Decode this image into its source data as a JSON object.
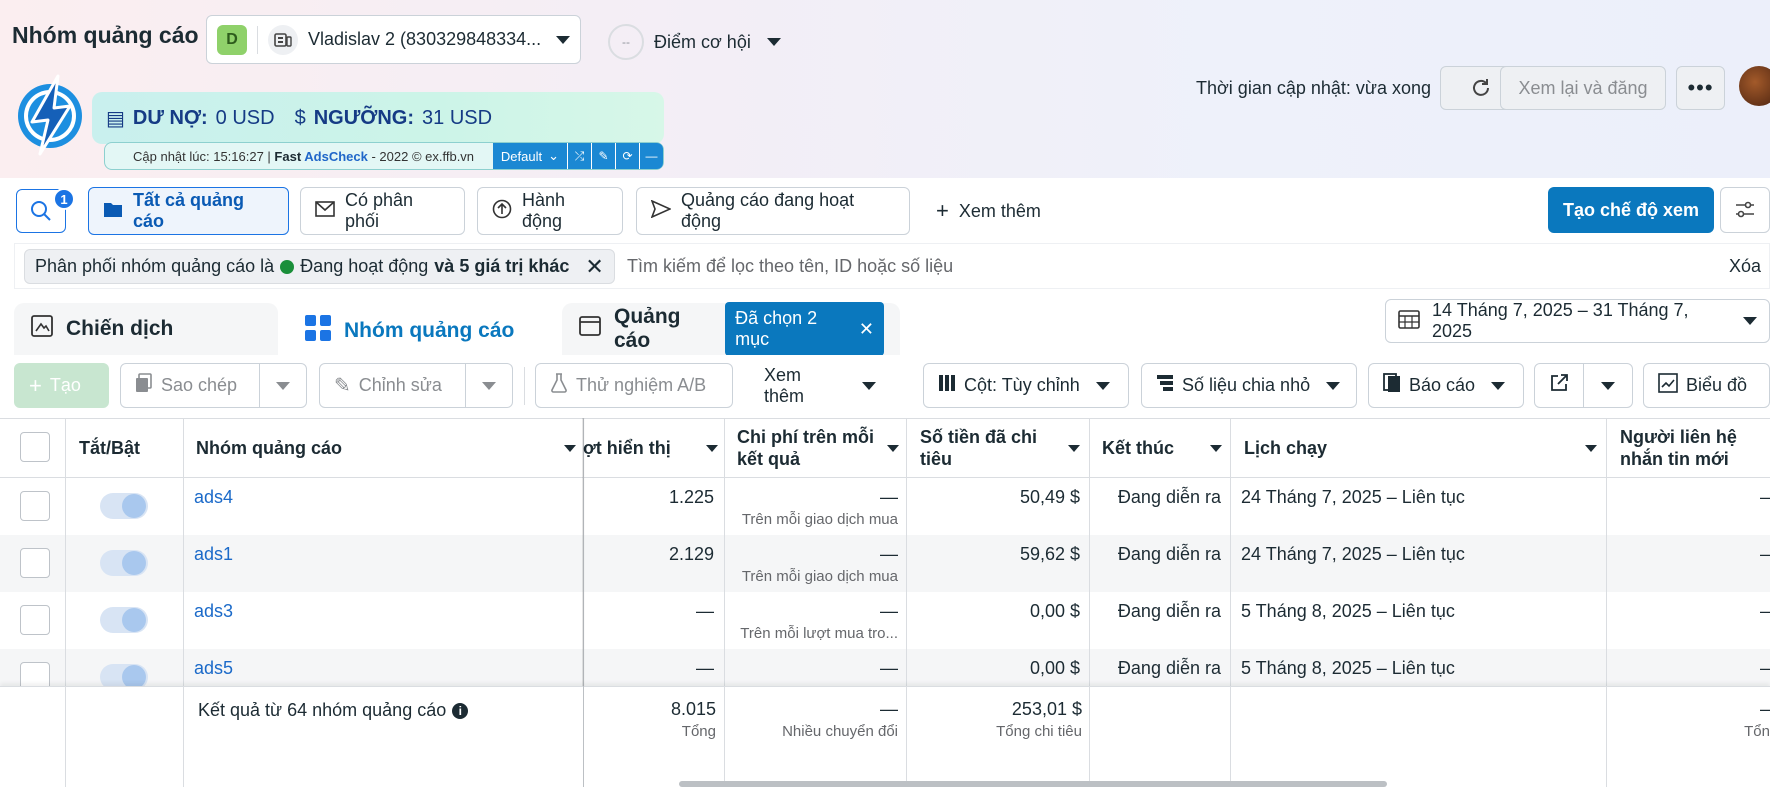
{
  "header": {
    "title": "Nhóm quảng cáo",
    "account_badge": "D",
    "account_name": "Vladislav 2 (830329848334...",
    "opportunity_circle": "--",
    "opportunity_label": "Điểm cơ hội",
    "update_time": "Thời gian cập nhật: vừa xong",
    "review_button": "Xem lại và đăng"
  },
  "extension": {
    "debt_label": "DƯ NỢ:",
    "debt_value": "0 USD",
    "threshold_label": "NGƯỠNG:",
    "threshold_value": "31 USD",
    "update_prefix": "Cập nhật lúc: 15:16:27 | ",
    "brand_fast": "Fast ",
    "brand_ads": "AdsCheck",
    "brand_suffix": " - 2022 © ex.ffb.vn",
    "dropdown": "Default"
  },
  "toolbar": {
    "search_count": "1",
    "tabs": [
      "Tất cả quảng cáo",
      "Có phân phối",
      "Hành động",
      "Quảng cáo đang hoạt động"
    ],
    "see_more": "Xem thêm",
    "create_view": "Tạo chế độ xem"
  },
  "filter": {
    "chip_prefix": "Phân phối nhóm quảng cáo là",
    "chip_status": "Đang hoạt động",
    "chip_more": "và 5 giá trị khác",
    "search_placeholder": "Tìm kiếm để lọc theo tên, ID hoặc số liệu",
    "clear": "Xóa"
  },
  "levels": {
    "campaign": "Chiến dịch",
    "adset": "Nhóm quảng cáo",
    "ad": "Quảng cáo",
    "selected": "Đã chọn 2 mục"
  },
  "date_range": "14 Tháng 7, 2025 – 31 Tháng 7, 2025",
  "actions": {
    "create": "Tạo",
    "copy": "Sao chép",
    "edit": "Chỉnh sửa",
    "ab_test": "Thử nghiệm A/B",
    "see_more": "Xem thêm",
    "columns": "Cột: Tùy chỉnh",
    "breakdown": "Số liệu chia nhỏ",
    "report": "Báo cáo",
    "chart": "Biểu đồ"
  },
  "table": {
    "headers": {
      "toggle": "Tắt/Bật",
      "name": "Nhóm quảng cáo",
      "impressions": "ợt hiển thị",
      "cpr_1": "Chi phí trên mỗi",
      "cpr_2": "kết quả",
      "spent_1": "Số tiền đã chi",
      "spent_2": "tiêu",
      "end": "Kết thúc",
      "schedule": "Lịch chạy",
      "contacts_1": "Người liên hệ",
      "contacts_2": "nhắn tin mới"
    },
    "rows": [
      {
        "name": "ads4",
        "impressions": "1.225",
        "cpr": "—",
        "cpr_sub": "Trên mỗi giao dịch mua",
        "spent": "50,49 $",
        "end": "Đang diễn ra",
        "schedule": "24 Tháng 7, 2025 – Liên tục",
        "contacts": "–"
      },
      {
        "name": "ads1",
        "impressions": "2.129",
        "cpr": "—",
        "cpr_sub": "Trên mỗi giao dịch mua",
        "spent": "59,62 $",
        "end": "Đang diễn ra",
        "schedule": "24 Tháng 7, 2025 – Liên tục",
        "contacts": "–"
      },
      {
        "name": "ads3",
        "impressions": "—",
        "cpr": "—",
        "cpr_sub": "Trên mỗi lượt mua tro...",
        "spent": "0,00 $",
        "end": "Đang diễn ra",
        "schedule": "5 Tháng 8, 2025 – Liên tục",
        "contacts": "–"
      },
      {
        "name": "ads5",
        "impressions": "—",
        "cpr": "—",
        "cpr_sub": "",
        "spent": "0,00 $",
        "end": "Đang diễn ra",
        "schedule": "5 Tháng 8, 2025 – Liên tục",
        "contacts": "–"
      }
    ],
    "footer": {
      "label": "Kết quả từ 64 nhóm quảng cáo",
      "impressions": "8.015",
      "impressions_sub": "Tổng",
      "cpr": "—",
      "cpr_sub": "Nhiều chuyển đổi",
      "spent": "253,01 $",
      "spent_sub": "Tổng chi tiêu",
      "contacts": "–",
      "contacts_sub": "Tổn"
    }
  }
}
